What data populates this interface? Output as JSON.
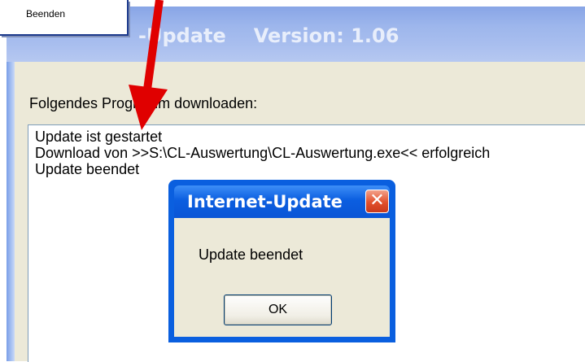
{
  "window": {
    "title": "-Update",
    "version": "Version: 1.06"
  },
  "menu": {
    "items": [
      "Beenden"
    ]
  },
  "main": {
    "prompt_label": "Folgendes Programm downloaden:",
    "log_lines": [
      "Update ist gestartet",
      "Download von >>S:\\CL-Auswertung\\CL-Auswertung.exe<< erfolgreich",
      "Update beendet"
    ]
  },
  "dialog": {
    "title": "Internet-Update",
    "close_glyph": "✕",
    "message": "Update beendet",
    "ok_label": "OK"
  },
  "colors": {
    "arrow": "#e00000",
    "titlebar": "#9db6ec",
    "dialog_title": "#0b5ee0",
    "close_button": "#e2502c",
    "dialog_face": "#ece9d8"
  }
}
